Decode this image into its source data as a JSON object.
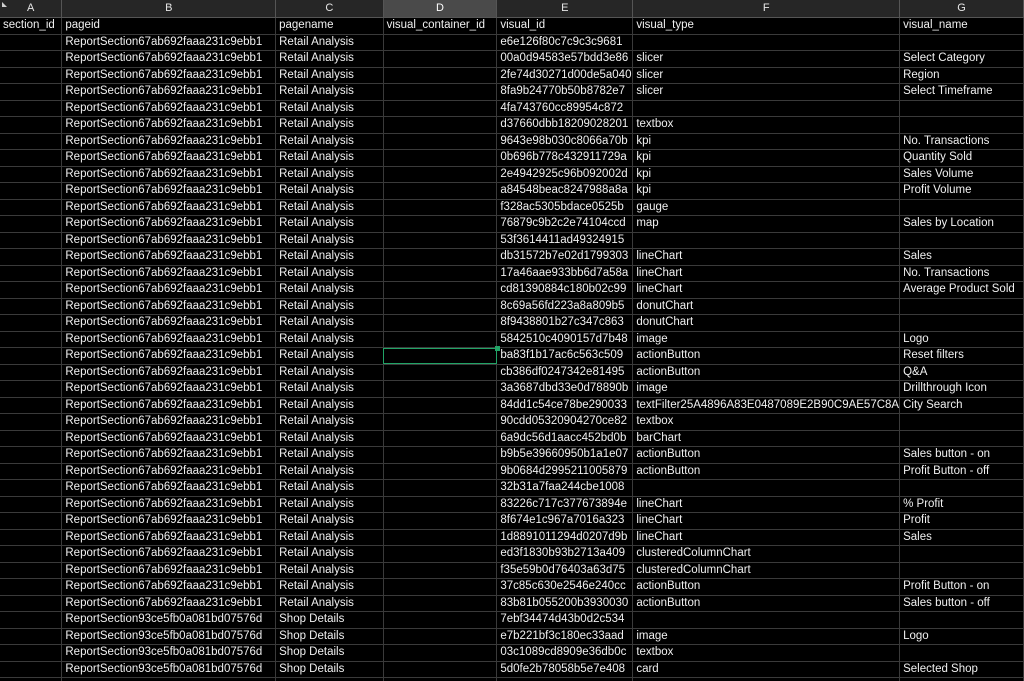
{
  "columns": [
    "A",
    "B",
    "C",
    "D",
    "E",
    "F",
    "G"
  ],
  "selected_column": "D",
  "active_cell": {
    "row": 20,
    "col": "D"
  },
  "rows": [
    [
      "section_id",
      "pageid",
      "pagename",
      "visual_container_id",
      "visual_id",
      "visual_type",
      "visual_name"
    ],
    [
      "",
      "ReportSection67ab692faaa231c9ebb1",
      "Retail Analysis",
      "",
      "e6e126f80c7c9c3c9681",
      "",
      ""
    ],
    [
      "",
      "ReportSection67ab692faaa231c9ebb1",
      "Retail Analysis",
      "",
      "00a0d94583e57bdd3e86",
      "slicer",
      "Select Category"
    ],
    [
      "",
      "ReportSection67ab692faaa231c9ebb1",
      "Retail Analysis",
      "",
      "2fe74d30271d00de5a040",
      "slicer",
      "Region"
    ],
    [
      "",
      "ReportSection67ab692faaa231c9ebb1",
      "Retail Analysis",
      "",
      "8fa9b24770b50b8782e7",
      "slicer",
      "Select Timeframe"
    ],
    [
      "",
      "ReportSection67ab692faaa231c9ebb1",
      "Retail Analysis",
      "",
      "4fa743760cc89954c872",
      "",
      ""
    ],
    [
      "",
      "ReportSection67ab692faaa231c9ebb1",
      "Retail Analysis",
      "",
      "d37660dbb18209028201",
      "textbox",
      ""
    ],
    [
      "",
      "ReportSection67ab692faaa231c9ebb1",
      "Retail Analysis",
      "",
      "9643e98b030c8066a70b",
      "kpi",
      "No. Transactions"
    ],
    [
      "",
      "ReportSection67ab692faaa231c9ebb1",
      "Retail Analysis",
      "",
      "0b696b778c432911729a",
      "kpi",
      "Quantity Sold"
    ],
    [
      "",
      "ReportSection67ab692faaa231c9ebb1",
      "Retail Analysis",
      "",
      "2e4942925c96b092002d",
      "kpi",
      "Sales Volume"
    ],
    [
      "",
      "ReportSection67ab692faaa231c9ebb1",
      "Retail Analysis",
      "",
      "a84548beac8247988a8a",
      "kpi",
      "Profit Volume"
    ],
    [
      "",
      "ReportSection67ab692faaa231c9ebb1",
      "Retail Analysis",
      "",
      "f328ac5305bdace0525b",
      "gauge",
      ""
    ],
    [
      "",
      "ReportSection67ab692faaa231c9ebb1",
      "Retail Analysis",
      "",
      "76879c9b2c2e74104ccd",
      "map",
      "Sales by Location"
    ],
    [
      "",
      "ReportSection67ab692faaa231c9ebb1",
      "Retail Analysis",
      "",
      "53f3614411ad49324915",
      "",
      ""
    ],
    [
      "",
      "ReportSection67ab692faaa231c9ebb1",
      "Retail Analysis",
      "",
      "db31572b7e02d1799303",
      "lineChart",
      "Sales"
    ],
    [
      "",
      "ReportSection67ab692faaa231c9ebb1",
      "Retail Analysis",
      "",
      "17a46aae933bb6d7a58a",
      "lineChart",
      "No. Transactions"
    ],
    [
      "",
      "ReportSection67ab692faaa231c9ebb1",
      "Retail Analysis",
      "",
      "cd81390884c180b02c99",
      "lineChart",
      "Average Product Sold"
    ],
    [
      "",
      "ReportSection67ab692faaa231c9ebb1",
      "Retail Analysis",
      "",
      "8c69a56fd223a8a809b5",
      "donutChart",
      ""
    ],
    [
      "",
      "ReportSection67ab692faaa231c9ebb1",
      "Retail Analysis",
      "",
      "8f9438801b27c347c863",
      "donutChart",
      ""
    ],
    [
      "",
      "ReportSection67ab692faaa231c9ebb1",
      "Retail Analysis",
      "",
      "5842510c4090157d7b48",
      "image",
      "Logo"
    ],
    [
      "",
      "ReportSection67ab692faaa231c9ebb1",
      "Retail Analysis",
      "",
      "ba83f1b17ac6c563c509",
      "actionButton",
      "Reset filters"
    ],
    [
      "",
      "ReportSection67ab692faaa231c9ebb1",
      "Retail Analysis",
      "",
      "cb386df0247342e81495",
      "actionButton",
      "Q&A"
    ],
    [
      "",
      "ReportSection67ab692faaa231c9ebb1",
      "Retail Analysis",
      "",
      "3a3687dbd33e0d78890b",
      "image",
      "Drillthrough Icon"
    ],
    [
      "",
      "ReportSection67ab692faaa231c9ebb1",
      "Retail Analysis",
      "",
      "84dd1c54ce78be290033",
      "textFilter25A4896A83E0487089E2B90C9AE57C8A",
      "City Search"
    ],
    [
      "",
      "ReportSection67ab692faaa231c9ebb1",
      "Retail Analysis",
      "",
      "90cdd05320904270ce82",
      "textbox",
      ""
    ],
    [
      "",
      "ReportSection67ab692faaa231c9ebb1",
      "Retail Analysis",
      "",
      "6a9dc56d1aacc452bd0b",
      "barChart",
      ""
    ],
    [
      "",
      "ReportSection67ab692faaa231c9ebb1",
      "Retail Analysis",
      "",
      "b9b5e39660950b1a1e07",
      "actionButton",
      "Sales button - on"
    ],
    [
      "",
      "ReportSection67ab692faaa231c9ebb1",
      "Retail Analysis",
      "",
      "9b0684d2995211005879",
      "actionButton",
      "Profit Button - off"
    ],
    [
      "",
      "ReportSection67ab692faaa231c9ebb1",
      "Retail Analysis",
      "",
      "32b31a7faa244cbe1008",
      "",
      ""
    ],
    [
      "",
      "ReportSection67ab692faaa231c9ebb1",
      "Retail Analysis",
      "",
      "83226c717c377673894e",
      "lineChart",
      "% Profit"
    ],
    [
      "",
      "ReportSection67ab692faaa231c9ebb1",
      "Retail Analysis",
      "",
      "8f674e1c967a7016a323",
      "lineChart",
      "Profit"
    ],
    [
      "",
      "ReportSection67ab692faaa231c9ebb1",
      "Retail Analysis",
      "",
      "1d8891011294d0207d9b",
      "lineChart",
      "Sales"
    ],
    [
      "",
      "ReportSection67ab692faaa231c9ebb1",
      "Retail Analysis",
      "",
      "ed3f1830b93b2713a409",
      "clusteredColumnChart",
      ""
    ],
    [
      "",
      "ReportSection67ab692faaa231c9ebb1",
      "Retail Analysis",
      "",
      "f35e59b0d76403a63d75",
      "clusteredColumnChart",
      ""
    ],
    [
      "",
      "ReportSection67ab692faaa231c9ebb1",
      "Retail Analysis",
      "",
      "37c85c630e2546e240cc",
      "actionButton",
      "Profit Button - on"
    ],
    [
      "",
      "ReportSection67ab692faaa231c9ebb1",
      "Retail Analysis",
      "",
      "83b81b055200b3930030",
      "actionButton",
      "Sales button - off"
    ],
    [
      "",
      "ReportSection93ce5fb0a081bd07576d",
      "Shop Details",
      "",
      "7ebf34474d43b0d2c534",
      "",
      ""
    ],
    [
      "",
      "ReportSection93ce5fb0a081bd07576d",
      "Shop Details",
      "",
      "e7b221bf3c180ec33aad",
      "image",
      "Logo"
    ],
    [
      "",
      "ReportSection93ce5fb0a081bd07576d",
      "Shop Details",
      "",
      "03c1089cd8909e36db0c",
      "textbox",
      ""
    ],
    [
      "",
      "ReportSection93ce5fb0a081bd07576d",
      "Shop Details",
      "",
      "5d0fe2b78058b5e7e408",
      "card",
      "Selected Shop"
    ],
    [
      "",
      "",
      "",
      "",
      "",
      "",
      ""
    ]
  ]
}
